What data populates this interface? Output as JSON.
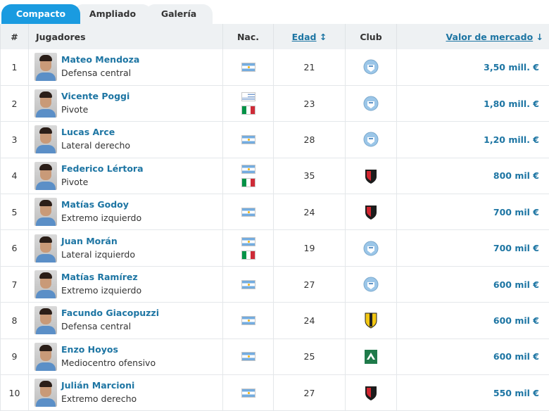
{
  "tabs": [
    {
      "label": "Compacto",
      "active": true
    },
    {
      "label": "Ampliado",
      "active": false
    },
    {
      "label": "Galería",
      "active": false
    }
  ],
  "columns": {
    "number": "#",
    "players": "Jugadores",
    "nationality": "Nac.",
    "age": "Edad",
    "age_sort_icon": "↕",
    "club": "Club",
    "market_value": "Valor de mercado",
    "market_value_sort_icon": "↓"
  },
  "colors": {
    "accent": "#1a9be0",
    "link": "#1d75a3",
    "header_bg": "#eef1f3"
  },
  "rows": [
    {
      "num": "1",
      "name": "Mateo Mendoza",
      "position": "Defensa central",
      "flags": [
        "argentina-flag"
      ],
      "age": "21",
      "club": "club-crest-lightblue",
      "value": "3,50 mill. €"
    },
    {
      "num": "2",
      "name": "Vicente Poggi",
      "position": "Pivote",
      "flags": [
        "uruguay-flag",
        "italy-flag"
      ],
      "age": "23",
      "club": "club-crest-lightblue",
      "value": "1,80 mill. €"
    },
    {
      "num": "3",
      "name": "Lucas Arce",
      "position": "Lateral derecho",
      "flags": [
        "argentina-flag"
      ],
      "age": "28",
      "club": "club-crest-lightblue",
      "value": "1,20 mill. €"
    },
    {
      "num": "4",
      "name": "Federico Lértora",
      "position": "Pivote",
      "flags": [
        "argentina-flag",
        "italy-flag"
      ],
      "age": "35",
      "club": "club-crest-red-black",
      "value": "800 mil €"
    },
    {
      "num": "5",
      "name": "Matías Godoy",
      "position": "Extremo izquierdo",
      "flags": [
        "argentina-flag"
      ],
      "age": "24",
      "club": "club-crest-red-black",
      "value": "700 mil €"
    },
    {
      "num": "6",
      "name": "Juan Morán",
      "position": "Lateral izquierdo",
      "flags": [
        "argentina-flag",
        "italy-flag"
      ],
      "age": "19",
      "club": "club-crest-lightblue",
      "value": "700 mil €"
    },
    {
      "num": "7",
      "name": "Matías Ramírez",
      "position": "Extremo izquierdo",
      "flags": [
        "argentina-flag"
      ],
      "age": "27",
      "club": "club-crest-lightblue",
      "value": "600 mil €"
    },
    {
      "num": "8",
      "name": "Facundo Giacopuzzi",
      "position": "Defensa central",
      "flags": [
        "argentina-flag"
      ],
      "age": "24",
      "club": "club-crest-yellow-black",
      "value": "600 mil €"
    },
    {
      "num": "9",
      "name": "Enzo Hoyos",
      "position": "Mediocentro ofensivo",
      "flags": [
        "argentina-flag"
      ],
      "age": "25",
      "club": "club-crest-green-white",
      "value": "600 mil €"
    },
    {
      "num": "10",
      "name": "Julián Marcioni",
      "position": "Extremo derecho",
      "flags": [
        "argentina-flag"
      ],
      "age": "27",
      "club": "club-crest-red-black",
      "value": "550 mil €"
    }
  ]
}
